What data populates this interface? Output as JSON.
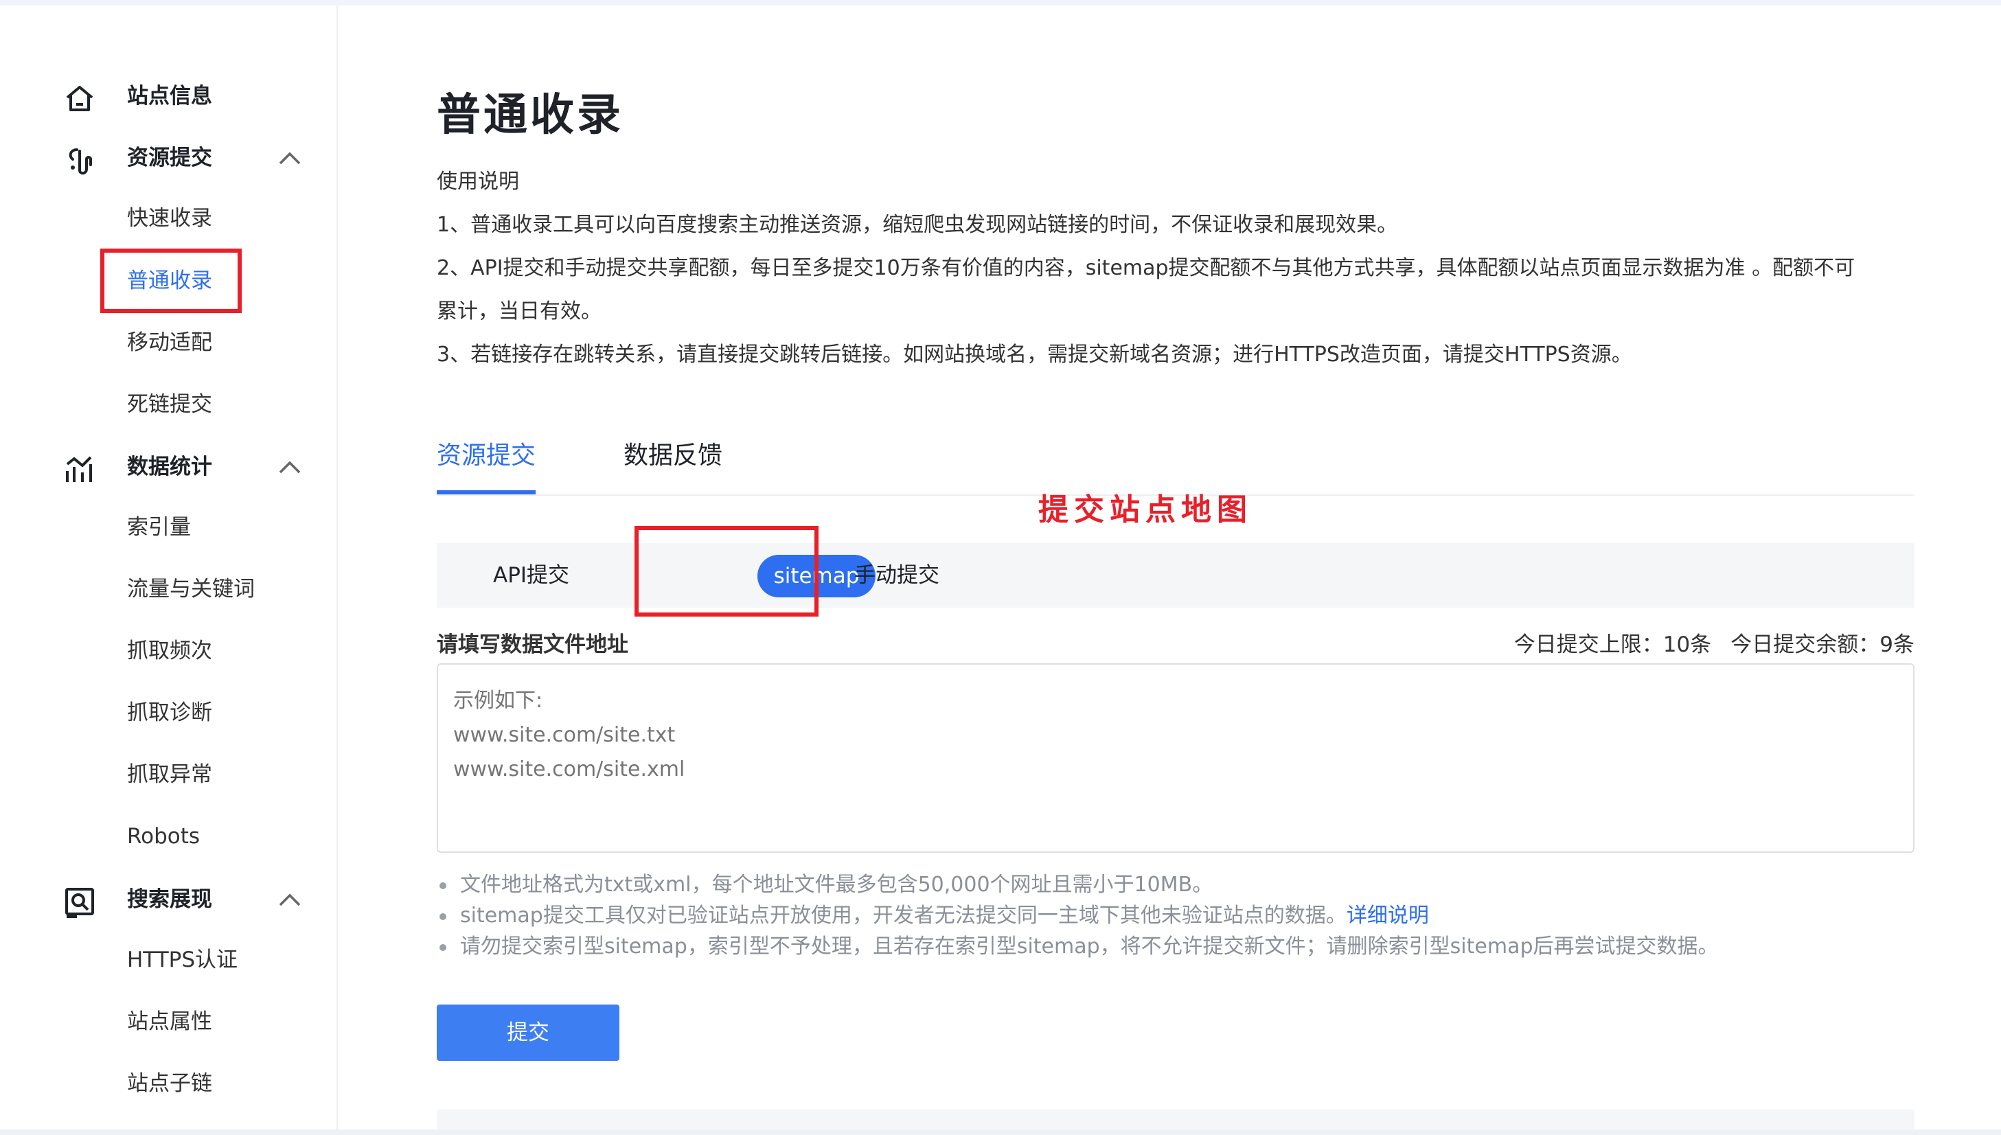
{
  "sidebar": {
    "groups": [
      {
        "label": "站点信息",
        "icon": "home-icon"
      },
      {
        "label": "资源提交",
        "icon": "submit-resource-icon",
        "items": [
          "快速收录",
          "普通收录",
          "移动适配",
          "死链提交"
        ]
      },
      {
        "label": "数据统计",
        "icon": "chart-icon",
        "items": [
          "索引量",
          "流量与关键词",
          "抓取频次",
          "抓取诊断",
          "抓取异常",
          "Robots"
        ]
      },
      {
        "label": "搜索展现",
        "icon": "search-display-icon",
        "items": [
          "HTTPS认证",
          "站点属性",
          "站点子链"
        ]
      }
    ],
    "active_item": "普通收录"
  },
  "main": {
    "title": "普通收录",
    "usage": {
      "heading": "使用说明",
      "lines": [
        "1、普通收录工具可以向百度搜索主动推送资源，缩短爬虫发现网站链接的时间，不保证收录和展现效果。",
        "2、API提交和手动提交共享配额，每日至多提交10万条有价值的内容，sitemap提交配额不与其他方式共享，具体配额以站点页面显示数据为准 。配额不可",
        "累计，当日有效。",
        "3、若链接存在跳转关系，请直接提交跳转后链接。如网站换域名，需提交新域名资源；进行HTTPS改造页面，请提交HTTPS资源。"
      ]
    },
    "tabs": [
      "资源提交",
      "数据反馈"
    ],
    "active_tab": "资源提交",
    "annotation": "提交站点地图",
    "subtabs": [
      "API提交",
      "sitemap",
      "手动提交"
    ],
    "active_subtab": "sitemap",
    "field_label": "请填写数据文件地址",
    "quota": {
      "limit": "今日提交上限：10条",
      "remaining": "今日提交余额：9条"
    },
    "textarea_placeholder": "示例如下:\nwww.site.com/site.txt\nwww.site.com/site.xml",
    "notes": [
      {
        "text": "文件地址格式为txt或xml，每个地址文件最多包含50,000个网址且需小于10MB。"
      },
      {
        "text": "sitemap提交工具仅对已验证站点开放使用，开发者无法提交同一主域下其他未验证站点的数据。",
        "link": "详细说明"
      },
      {
        "text": "请勿提交索引型sitemap，索引型不予处理，且若存在索引型sitemap，将不允许提交新文件；请删除索引型sitemap后再尝试提交数据。"
      }
    ],
    "submit_label": "提交"
  },
  "colors": {
    "accent": "#2d6ff0",
    "annotation_red": "#e8202a"
  }
}
